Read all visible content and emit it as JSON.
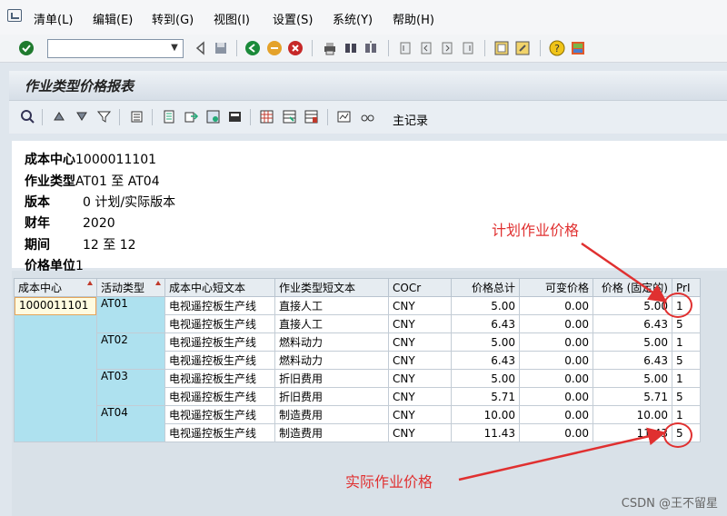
{
  "menu": {
    "items": [
      "清单(L)",
      "编辑(E)",
      "转到(G)",
      "视图(I)",
      "设置(S)",
      "系统(Y)",
      "帮助(H)"
    ]
  },
  "toolbar": {
    "command_value": "",
    "icons": [
      "enter-icon",
      "back-icon",
      "save-icon",
      "back-arrow-icon",
      "exit-icon",
      "cancel-icon",
      "print-icon",
      "find-icon",
      "find-next-icon",
      "first-page-icon",
      "previous-page-icon",
      "next-page-icon",
      "last-page-icon",
      "create-session-icon",
      "shortcut-icon",
      "help-icon",
      "customize-icon"
    ]
  },
  "title": "作业类型价格报表",
  "app_toolbar": {
    "master_record_label": "主记录",
    "icons": [
      "details-icon",
      "sort-ascending-icon",
      "sort-descending-icon",
      "filter-icon",
      "total-icon",
      "print-preview-icon",
      "export-icon",
      "word-icon",
      "excel-icon",
      "layout-icon",
      "choose-layout-icon",
      "save-layout-icon",
      "glasses-icon"
    ]
  },
  "header": {
    "cost_center_label": "成本中心",
    "cost_center_value": "1000011101",
    "activity_type_label": "作业类型",
    "activity_type_value": "AT01 至 AT04",
    "version_label": "版本",
    "version_value": "0 计划/实际版本",
    "fiscal_year_label": "财年",
    "fiscal_year_value": "2020",
    "period_label": "期间",
    "period_value": "12 至 12",
    "price_unit_label": "价格单位",
    "price_unit_value": "1"
  },
  "table": {
    "columns": [
      "成本中心",
      "活动类型",
      "成本中心短文本",
      "作业类型短文本",
      "COCr",
      "价格总计",
      "可变价格",
      "价格 (固定的)",
      "PrI"
    ],
    "rows": [
      {
        "cc": "1000011101",
        "at": "AT01",
        "cc_text": "电视遥控板生产线",
        "at_text": "直接人工",
        "cur": "CNY",
        "total": "5.00",
        "var": "0.00",
        "fixed": "5.00",
        "pri": "1"
      },
      {
        "cc": "",
        "at": "",
        "cc_text": "电视遥控板生产线",
        "at_text": "直接人工",
        "cur": "CNY",
        "total": "6.43",
        "var": "0.00",
        "fixed": "6.43",
        "pri": "5"
      },
      {
        "cc": "",
        "at": "AT02",
        "cc_text": "电视遥控板生产线",
        "at_text": "燃料动力",
        "cur": "CNY",
        "total": "5.00",
        "var": "0.00",
        "fixed": "5.00",
        "pri": "1"
      },
      {
        "cc": "",
        "at": "",
        "cc_text": "电视遥控板生产线",
        "at_text": "燃料动力",
        "cur": "CNY",
        "total": "6.43",
        "var": "0.00",
        "fixed": "6.43",
        "pri": "5"
      },
      {
        "cc": "",
        "at": "AT03",
        "cc_text": "电视遥控板生产线",
        "at_text": "折旧费用",
        "cur": "CNY",
        "total": "5.00",
        "var": "0.00",
        "fixed": "5.00",
        "pri": "1"
      },
      {
        "cc": "",
        "at": "",
        "cc_text": "电视遥控板生产线",
        "at_text": "折旧费用",
        "cur": "CNY",
        "total": "5.71",
        "var": "0.00",
        "fixed": "5.71",
        "pri": "5"
      },
      {
        "cc": "",
        "at": "AT04",
        "cc_text": "电视遥控板生产线",
        "at_text": "制造费用",
        "cur": "CNY",
        "total": "10.00",
        "var": "0.00",
        "fixed": "10.00",
        "pri": "1"
      },
      {
        "cc": "",
        "at": "",
        "cc_text": "电视遥控板生产线",
        "at_text": "制造费用",
        "cur": "CNY",
        "total": "11.43",
        "var": "0.00",
        "fixed": "11.43",
        "pri": "5"
      }
    ]
  },
  "annotations": {
    "planned": "计划作业价格",
    "actual": "实际作业价格",
    "color": "#e03030"
  },
  "watermark": "CSDN @王不留星"
}
